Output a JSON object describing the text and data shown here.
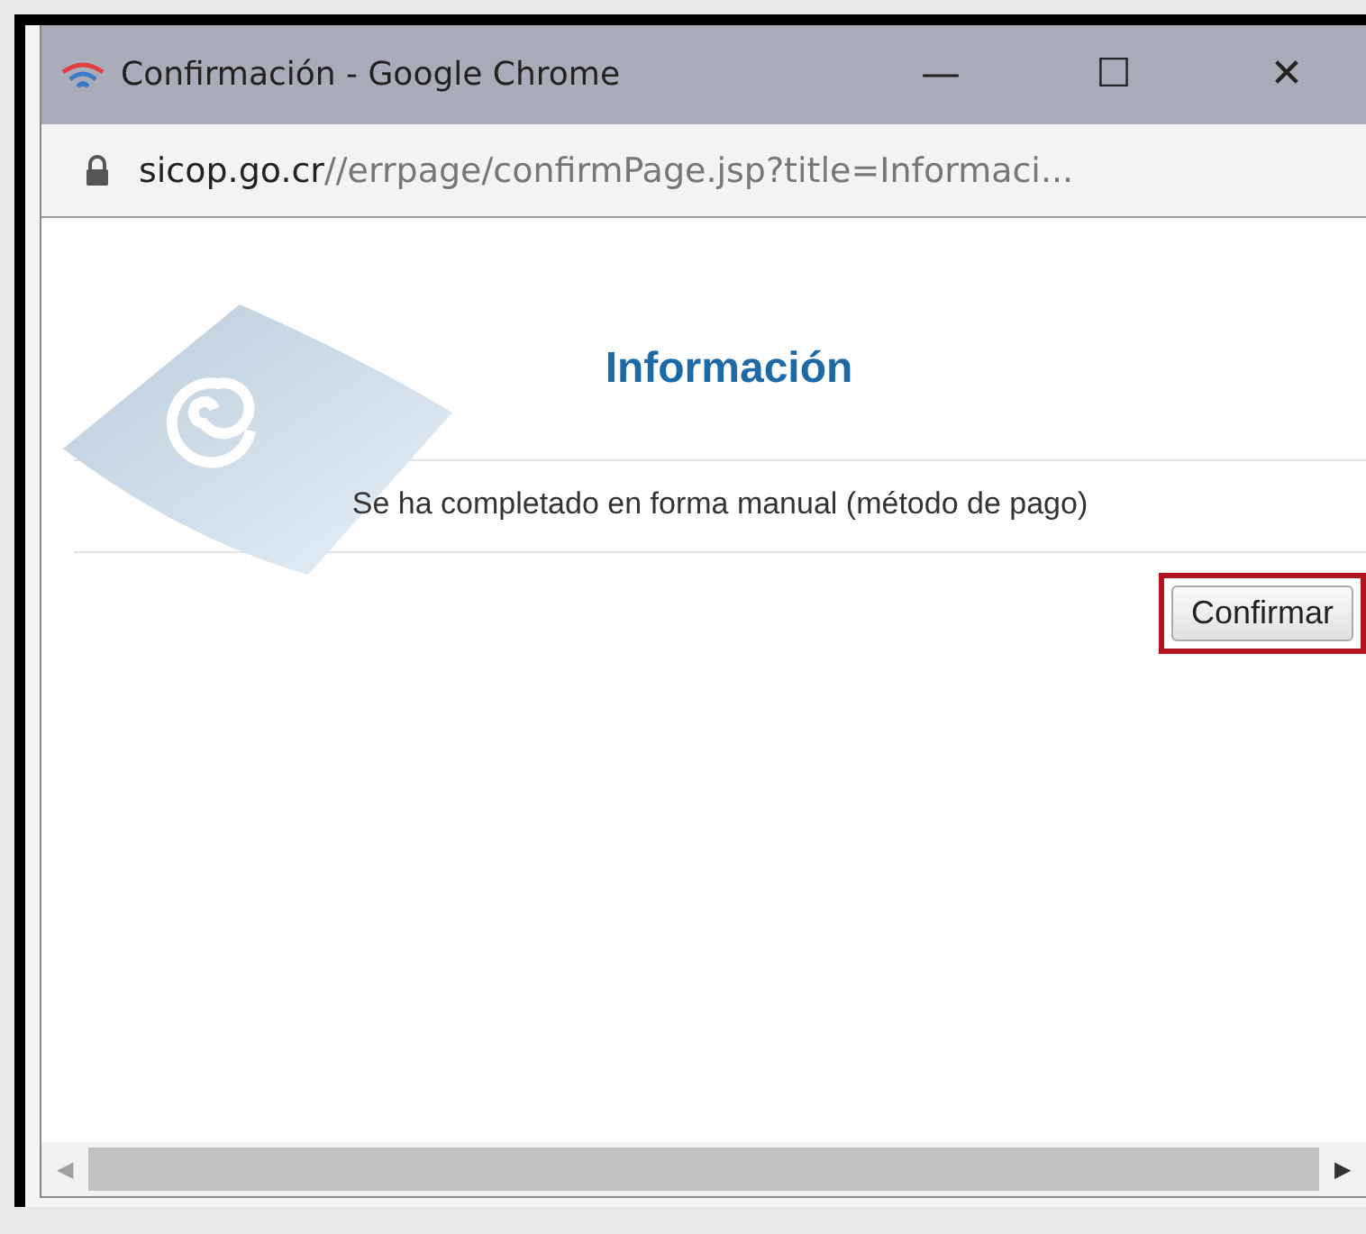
{
  "window": {
    "title": "Confirmación - Google Chrome",
    "controls": [
      "—",
      "☐",
      "✕"
    ]
  },
  "address_bar": {
    "host": "sicop.go.cr",
    "path": "//errpage/confirmPage.jsp?title=Informaci..."
  },
  "dialog": {
    "heading": "Información",
    "message": "Se ha completado en forma manual (método de pago)",
    "button": "Confirmar",
    "button_highlighted": true
  },
  "scrollbar": {
    "left": "◀",
    "right": "▶"
  }
}
